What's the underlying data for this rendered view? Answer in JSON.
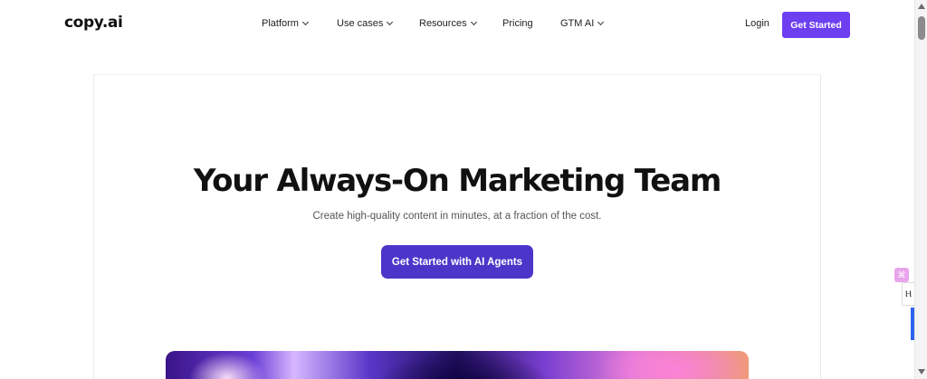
{
  "header": {
    "logo": "copy.ai",
    "menu": [
      {
        "label": "Platform",
        "dropdown": true
      },
      {
        "label": "Use cases",
        "dropdown": true
      },
      {
        "label": "Resources",
        "dropdown": true
      },
      {
        "label": "Pricing",
        "dropdown": false
      },
      {
        "label": "GTM AI",
        "dropdown": true
      }
    ],
    "login_label": "Login",
    "cta_label": "Get Started"
  },
  "hero": {
    "title": "Your Always-On Marketing Team",
    "subtitle": "Create high-quality content in minutes, at a fraction of the cost.",
    "cta_label": "Get Started with AI Agents"
  },
  "side_widget": {
    "glyph": "⌘",
    "mid_glyph": "Ⲏ"
  },
  "colors": {
    "brand_purple": "#6d3ff0",
    "hero_cta": "#4b36c9",
    "widget_pink": "#e8a5ec",
    "widget_blue": "#2c64f0"
  }
}
